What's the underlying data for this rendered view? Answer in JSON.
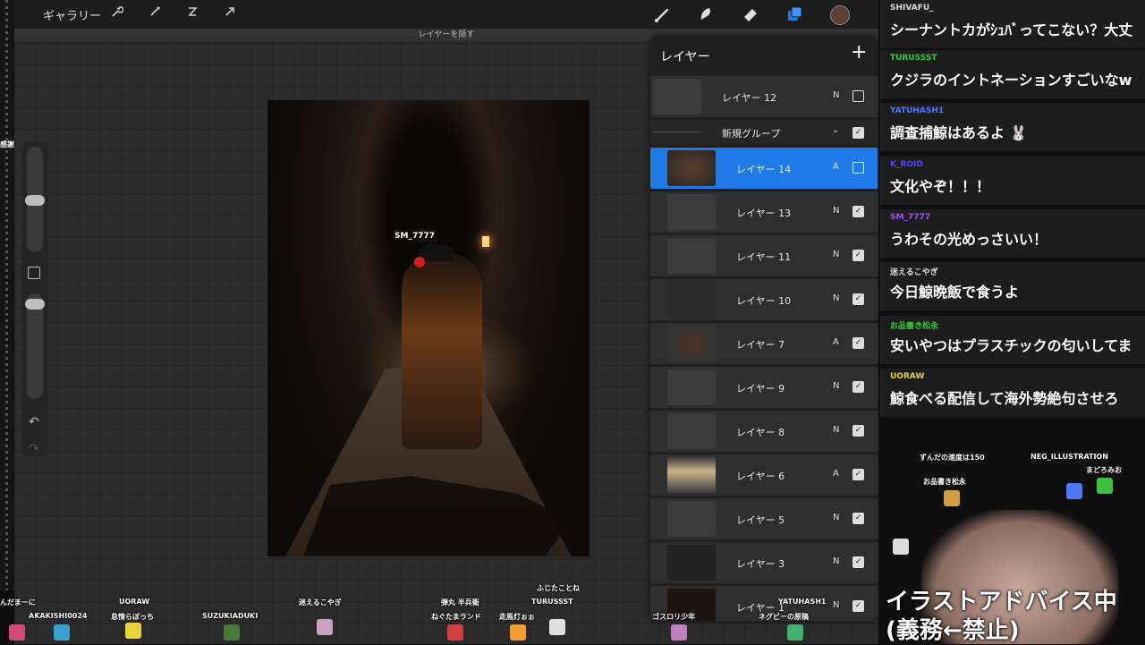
{
  "app": {
    "gallery_label": "ギャラリー",
    "hint_text": "レイヤーを隠す"
  },
  "canvas": {
    "user_tag": "SM_7777"
  },
  "layers_panel": {
    "title": "レイヤー",
    "add_icon": "+",
    "items": [
      {
        "name": "レイヤー 12",
        "mode": "N",
        "visible": false
      },
      {
        "name": "新規グループ",
        "mode": "",
        "visible": true
      },
      {
        "name": "レイヤー 14",
        "mode": "A",
        "visible": false
      },
      {
        "name": "レイヤー 13",
        "mode": "N",
        "visible": true
      },
      {
        "name": "レイヤー 11",
        "mode": "N",
        "visible": true
      },
      {
        "name": "レイヤー 10",
        "mode": "N",
        "visible": true
      },
      {
        "name": "レイヤー 7",
        "mode": "A",
        "visible": true
      },
      {
        "name": "レイヤー 9",
        "mode": "N",
        "visible": true
      },
      {
        "name": "レイヤー 8",
        "mode": "N",
        "visible": true
      },
      {
        "name": "レイヤー 6",
        "mode": "A",
        "visible": true
      },
      {
        "name": "レイヤー 5",
        "mode": "N",
        "visible": true
      },
      {
        "name": "レイヤー 3",
        "mode": "N",
        "visible": true
      },
      {
        "name": "レイヤー 1",
        "mode": "N",
        "visible": true
      }
    ]
  },
  "chat": {
    "messages": [
      {
        "user": "SHIVAFU_",
        "text": "シーナントカがｼｭﾊﾞってこない？大丈",
        "color": "#dddddd"
      },
      {
        "user": "TURUSSST",
        "text": "クジラのイントネーションすごいなw",
        "color": "#33cc33"
      },
      {
        "user": "YATUHASH1",
        "text": "調査捕鯨はあるよ 🐰",
        "color": "#4a78ff"
      },
      {
        "user": "K_ROID",
        "text": "文化やぞ！！！",
        "color": "#5a44ff"
      },
      {
        "user": "SM_7777",
        "text": "うわその光めっさいい！",
        "color": "#a64dff"
      },
      {
        "user": "迷えるこやぎ",
        "text": "今日鯨晩飯で食うよ",
        "color": "#dddddd"
      },
      {
        "user": "お品書き松永",
        "text": "安いやつはプラスチックの匂いしてま",
        "color": "#33cc33"
      },
      {
        "user": "UORAW",
        "text": "鯨食べる配信して海外勢絶句させろ",
        "color": "#e8d23a"
      }
    ]
  },
  "overlay": {
    "names": [
      "ずんだの速度は150",
      "NEG_ILLUSTRATION",
      "まどろみお",
      "お品書き松永",
      "んだまーに",
      "AKAKISHI0024",
      "UORAW",
      "怠惰らぼっち",
      "SUZUKIADUKI",
      "迷えるこやぎ",
      "弾丸 半兵衛",
      "ねぐたまランド",
      "走馬灯ぉぉ",
      "ふじたことね",
      "TURUSSST",
      "ゴスロリ少年",
      "YATUHASH1",
      "ネグビーの原稿",
      "感謝"
    ],
    "banner_line1": "イラストアドバイス中",
    "banner_line2": "(義務←禁止)"
  }
}
